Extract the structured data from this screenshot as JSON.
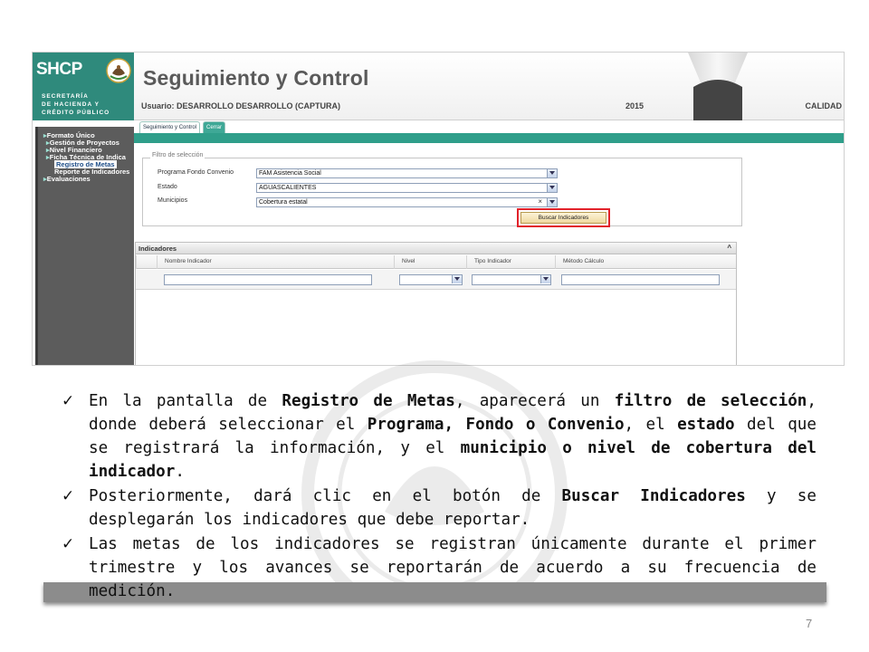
{
  "header": {
    "logo": "SHCP",
    "dept_lines": [
      "SECRETARÍA",
      "DE HACIENDA Y",
      "CRÉDITO PÚBLICO"
    ],
    "app_title": "Seguimiento y Control",
    "user_line": "Usuario: DESARROLLO DESARROLLO (CAPTURA)",
    "year": "2015",
    "calidad": "CALIDAD"
  },
  "tabs": [
    {
      "label": "Seguimiento y Control"
    },
    {
      "label": "Cerrar"
    }
  ],
  "sidebar": {
    "items": [
      {
        "label": "Formato Único"
      },
      {
        "label": "Gestión de Proyectos"
      },
      {
        "label": "Nivel Financiero"
      },
      {
        "label": "Ficha Técnica de Indica"
      },
      {
        "label": "Registro de Metas"
      },
      {
        "label": "Reporte de Indicadores"
      },
      {
        "label": "Evaluaciones"
      }
    ]
  },
  "filter": {
    "legend": "Filtro de selección",
    "fields": [
      {
        "label": "Programa Fondo Convenio",
        "value": "FAM Asistencia Social"
      },
      {
        "label": "Estado",
        "value": "AGUASCALIENTES"
      },
      {
        "label": "Municipios",
        "value": "Cobertura estatal"
      }
    ],
    "clear_symbol": "×",
    "search_button": "Buscar Indicadores"
  },
  "indicators": {
    "title": "Indicadores",
    "collapse_symbol": "^",
    "columns": [
      "Nombre Indicador",
      "Nivel",
      "Tipo Indicador",
      "Método Cálculo"
    ]
  },
  "slide": {
    "bullets": [
      [
        {
          "t": "En la pantalla de ",
          "b": false
        },
        {
          "t": "Registro de Metas",
          "b": true
        },
        {
          "t": ", aparecerá un ",
          "b": false
        },
        {
          "t": "filtro de selección",
          "b": true
        },
        {
          "t": ", donde deberá seleccionar el ",
          "b": false
        },
        {
          "t": "Programa, Fondo o Convenio",
          "b": true
        },
        {
          "t": ", el ",
          "b": false
        },
        {
          "t": "estado",
          "b": true
        },
        {
          "t": " del que se registrará la información, y el ",
          "b": false
        },
        {
          "t": "municipio o nivel de cobertura del indicador",
          "b": true
        },
        {
          "t": ".",
          "b": false
        }
      ],
      [
        {
          "t": "Posteriormente, dará clic en el botón de ",
          "b": false
        },
        {
          "t": "Buscar Indicadores",
          "b": true
        },
        {
          "t": " y se desplegarán los indicadores que debe reportar.",
          "b": false
        }
      ],
      [
        {
          "t": "Las metas de los indicadores se registran únicamente durante el primer trimestre y los avances se reportarán de acuerdo a su frecuencia de medición.",
          "b": false
        }
      ]
    ],
    "check_symbol": "✓",
    "page_number": "7"
  },
  "colors": {
    "teal": "#2f9e8a",
    "highlight": "#e2222b",
    "sidebar": "#5c5c5c"
  }
}
